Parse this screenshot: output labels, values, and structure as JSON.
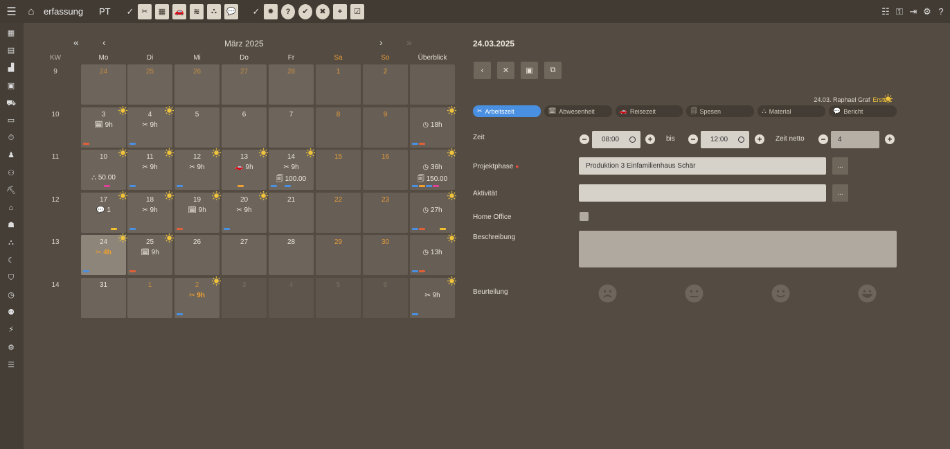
{
  "topbar": {
    "menu_icon": "hamburger-icon",
    "home_icon": "home-icon",
    "title": "erfassung",
    "user_code": "PT",
    "group1": [
      "tools-icon",
      "calendar-icon",
      "car-icon",
      "coins-icon",
      "sitemap-icon",
      "comment-icon"
    ],
    "group2": [
      "gear-icon",
      "question-icon",
      "check-circle-icon",
      "x-circle-icon",
      "plus-square-icon",
      "check-square-icon"
    ],
    "right_icons": [
      "sliders-icon",
      "key-icon",
      "logout-icon",
      "settings-icon",
      "help-icon"
    ]
  },
  "sidebar": {
    "icons": [
      "calendar-grid-icon",
      "calendar-icon",
      "chart-icon",
      "calendar-check-icon",
      "truck-icon",
      "monitor-icon",
      "stopwatch-icon",
      "user-plus-icon",
      "users-icon",
      "dolly-icon",
      "warehouse-icon",
      "address-book-icon",
      "sitemap-icon",
      "moon-icon",
      "tags-icon",
      "clock-icon",
      "group-icon",
      "plug-icon",
      "cog-icon",
      "list-icon"
    ]
  },
  "calendar": {
    "prev_year": "«",
    "prev_month": "‹",
    "month_label": "März 2025",
    "next_month": "›",
    "next_year": "»",
    "headers": [
      "KW",
      "Mo",
      "Di",
      "Mi",
      "Do",
      "Fr",
      "Sa",
      "So",
      "Überblick"
    ],
    "weeks": [
      {
        "kw": "9",
        "days": [
          {
            "d": "24",
            "cls": "other"
          },
          {
            "d": "25",
            "cls": "other"
          },
          {
            "d": "26",
            "cls": "other"
          },
          {
            "d": "27",
            "cls": "other"
          },
          {
            "d": "28",
            "cls": "other"
          },
          {
            "d": "1",
            "cls": "wk"
          },
          {
            "d": "2",
            "cls": "wk"
          },
          {
            "d": "",
            "cls": "wk"
          }
        ]
      },
      {
        "kw": "10",
        "days": [
          {
            "d": "3",
            "l1": "🗓 9h",
            "sun": true,
            "bars": [
              "#e0603a"
            ]
          },
          {
            "d": "4",
            "l1": "✂ 9h",
            "sun": true,
            "bars": [
              "#4a90e2"
            ]
          },
          {
            "d": "5"
          },
          {
            "d": "6"
          },
          {
            "d": "7"
          },
          {
            "d": "8",
            "cls": "wk"
          },
          {
            "d": "9",
            "cls": "wk"
          },
          {
            "d": "",
            "cls": "wk",
            "l1": "◷ 18h",
            "sun": true,
            "bars": [
              "#4a90e2",
              "#e0603a"
            ]
          }
        ]
      },
      {
        "kw": "11",
        "days": [
          {
            "d": "10",
            "l2": "⛬ 50.00",
            "sun": true,
            "bars": [
              "",
              "",
              "",
              "#e0409a"
            ]
          },
          {
            "d": "11",
            "l1": "✂ 9h",
            "sun": true,
            "bars": [
              "#4a90e2"
            ]
          },
          {
            "d": "12",
            "l1": "✂ 9h",
            "sun": true,
            "bars": [
              "#4a90e2"
            ]
          },
          {
            "d": "13",
            "l1": "🚗 9h",
            "sun": true,
            "bars": [
              "",
              "",
              "#f0a030"
            ]
          },
          {
            "d": "14",
            "l1": "✂ 9h",
            "l2": "🗐 100.00",
            "sun": true,
            "bars": [
              "#4a90e2",
              "",
              "#4a90e2"
            ]
          },
          {
            "d": "15",
            "cls": "wk"
          },
          {
            "d": "16",
            "cls": "wk"
          },
          {
            "d": "",
            "cls": "wk",
            "l1": "◷ 36h",
            "l2": "🗐 150.00",
            "sun": true,
            "bars": [
              "#4a90e2",
              "#f0a030",
              "#4a90e2",
              "#e0409a"
            ]
          }
        ]
      },
      {
        "kw": "12",
        "days": [
          {
            "d": "17",
            "l1": "💬 1",
            "sun": true,
            "bars": [
              "",
              "",
              "",
              "",
              "#f0c030"
            ]
          },
          {
            "d": "18",
            "l1": "✂ 9h",
            "sun": true,
            "bars": [
              "#4a90e2"
            ]
          },
          {
            "d": "19",
            "l1": "🗓 9h",
            "sun": true,
            "bars": [
              "#e0603a"
            ]
          },
          {
            "d": "20",
            "l1": "✂ 9h",
            "sun": true,
            "bars": [
              "#4a90e2"
            ]
          },
          {
            "d": "21"
          },
          {
            "d": "22",
            "cls": "wk"
          },
          {
            "d": "23",
            "cls": "wk"
          },
          {
            "d": "",
            "cls": "wk",
            "l1": "◷ 27h",
            "sun": true,
            "bars": [
              "#4a90e2",
              "#e0603a",
              "",
              "",
              "#f0c030"
            ]
          }
        ]
      },
      {
        "kw": "13",
        "days": [
          {
            "d": "24",
            "cls": "sel",
            "l1": "✂ 4h",
            "sun": true,
            "bars": [
              "#4a90e2"
            ],
            "accent": true
          },
          {
            "d": "25",
            "l1": "🗓 9h",
            "sun": true,
            "bars": [
              "#e0603a"
            ]
          },
          {
            "d": "26"
          },
          {
            "d": "27"
          },
          {
            "d": "28"
          },
          {
            "d": "29",
            "cls": "wk"
          },
          {
            "d": "30",
            "cls": "wk"
          },
          {
            "d": "",
            "cls": "wk",
            "l1": "◷ 13h",
            "sun": true,
            "bars": [
              "#4a90e2",
              "#e0603a"
            ]
          }
        ]
      },
      {
        "kw": "14",
        "days": [
          {
            "d": "31"
          },
          {
            "d": "1",
            "cls": "other"
          },
          {
            "d": "2",
            "cls": "other",
            "l1": "✂ 9h",
            "sun": true,
            "bars": [
              "#4a90e2"
            ],
            "accent": true
          },
          {
            "d": "3",
            "cls": "dim faint"
          },
          {
            "d": "4",
            "cls": "dim faint"
          },
          {
            "d": "5",
            "cls": "dim faint"
          },
          {
            "d": "6",
            "cls": "dim faint"
          },
          {
            "d": "",
            "cls": "wk",
            "l1": "✂ 9h",
            "sun": true,
            "bars": [
              "#4a90e2"
            ]
          }
        ]
      }
    ]
  },
  "detail": {
    "date": "24.03.2025",
    "actions": [
      "back-icon",
      "close-icon",
      "save-icon",
      "copy-icon"
    ],
    "action_glyphs": [
      "‹",
      "✕",
      "▣",
      "⧉"
    ],
    "meta_text": "24.03. Raphael Graf",
    "meta_status": "Erstellt",
    "tabs": [
      {
        "icon": "✂",
        "label": "Arbeitszeit",
        "active": true
      },
      {
        "icon": "🗓",
        "label": "Abwesenheit"
      },
      {
        "icon": "🚗",
        "label": "Reisezeit"
      },
      {
        "icon": "🗐",
        "label": "Spesen"
      },
      {
        "icon": "⛬",
        "label": "Material"
      },
      {
        "icon": "💬",
        "label": "Bericht"
      }
    ],
    "zeit_label": "Zeit",
    "start": "08:00",
    "bis_label": "bis",
    "end": "12:00",
    "netto_label": "Zeit netto",
    "netto": "4",
    "projektphase_label": "Projektphase",
    "projektphase": "Produktion 3 Einfamilienhaus Schär",
    "aktivitaet_label": "Aktivität",
    "aktivitaet": "",
    "dots": "...",
    "homeoffice_label": "Home Office",
    "beschreibung_label": "Beschreibung",
    "beurteilung_label": "Beurteilung",
    "ratings": [
      "sad-face-icon",
      "neutral-face-icon",
      "smile-face-icon",
      "happy-face-icon"
    ]
  }
}
